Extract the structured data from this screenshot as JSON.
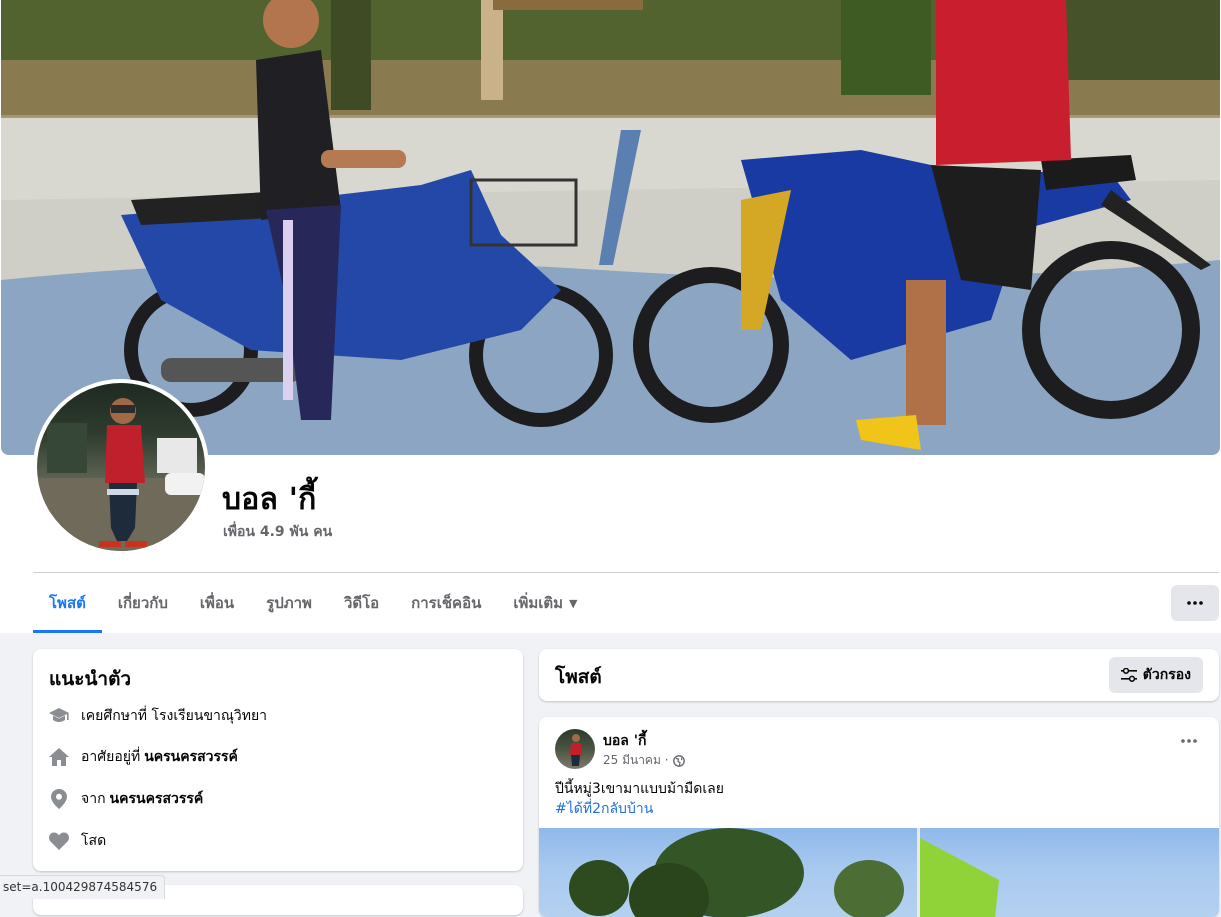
{
  "profile": {
    "name": "บอล 'กี้",
    "friends_count": "เพื่อน 4.9 พัน คน"
  },
  "tabs": [
    {
      "label": "โพสต์",
      "active": true
    },
    {
      "label": "เกี่ยวกับ"
    },
    {
      "label": "เพื่อน"
    },
    {
      "label": "รูปภาพ"
    },
    {
      "label": "วิดีโอ"
    },
    {
      "label": "การเช็คอิน"
    },
    {
      "label": "เพิ่มเติม"
    }
  ],
  "intro": {
    "title": "แนะนำตัว",
    "items": [
      {
        "icon": "graduation-cap-icon",
        "text": "เคยศึกษาที่ โรงเรียนขาณุวิทยา",
        "bold": ""
      },
      {
        "icon": "home-icon",
        "text": "อาศัยอยู่ที่",
        "bold": "นครนครสวรรค์"
      },
      {
        "icon": "location-pin-icon",
        "text": "จาก",
        "bold": "นครนครสวรรค์"
      },
      {
        "icon": "heart-icon",
        "text": "โสด",
        "bold": ""
      }
    ]
  },
  "posts_section": {
    "title": "โพสต์",
    "filter_label": "ตัวกรอง"
  },
  "post": {
    "author": "บอล 'กี้",
    "date": "25 มีนาคม ·",
    "text": "ปีนี้หมู่3เขามาแบบม้ามืดเลย",
    "hashtag": "#ได้ที่2กลับบ้าน"
  },
  "status_bar": {
    "url": "set=a.100429874584576"
  },
  "colors": {
    "accent": "#1877f2",
    "secondary_text": "#65676b",
    "page_background": "#f0f2f5"
  }
}
